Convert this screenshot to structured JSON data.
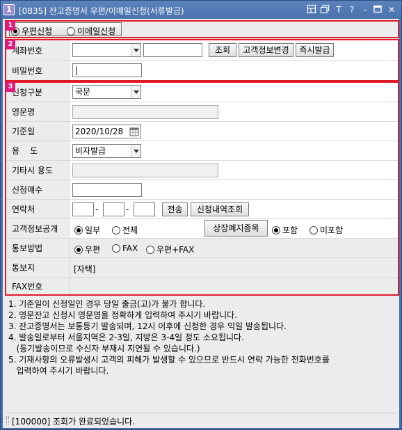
{
  "window": {
    "badge": "1",
    "title": "[0835] 잔고증명서 우편/이메일신청(서류발급)",
    "tools": [
      "layout-icon",
      "copy-window-icon",
      "text-size-icon",
      "help-icon",
      "minimize-icon",
      "maximize-icon",
      "close-icon"
    ],
    "tool_glyphs": {
      "text": "T",
      "help": "?",
      "minimize": "–",
      "close": "✕"
    }
  },
  "section1": {
    "badge": "1",
    "tabs": [
      {
        "label": "우편신청",
        "selected": true
      },
      {
        "label": "이메일신청",
        "selected": false
      }
    ]
  },
  "section2": {
    "badge": "2",
    "account_label": "계좌번호",
    "account_select_value": "",
    "account_name_value": "",
    "btn_inquiry": "조회",
    "btn_change_info": "고객정보변경",
    "btn_issue_now": "즉시발급",
    "password_label": "비밀번호",
    "password_value": "|"
  },
  "section3": {
    "badge": "3",
    "request_type_label": "신청구분",
    "request_type_value": "국문",
    "english_name_label": "영문명",
    "base_date_label": "기준일",
    "base_date_value": "2020/10/28",
    "purpose_label": "용    도",
    "purpose_value": "비자발급",
    "other_purpose_label": "기타시 용도",
    "copies_label": "신청매수",
    "contact_label": "연락처",
    "contact_dash": "-",
    "btn_send": "전송",
    "btn_history": "신청내역조회",
    "disclosure_label": "고객정보공개",
    "disclosure_opts": [
      {
        "label": "일부",
        "selected": true
      },
      {
        "label": "전체",
        "selected": false
      }
    ],
    "btn_delisted": "상장폐지종목",
    "include_opts": [
      {
        "label": "포함",
        "selected": true
      },
      {
        "label": "미포함",
        "selected": false
      }
    ],
    "notify_method_label": "통보방법",
    "notify_opts": [
      {
        "label": "우편",
        "selected": true
      },
      {
        "label": "FAX",
        "selected": false
      },
      {
        "label": "우편+FAX",
        "selected": false
      }
    ],
    "notify_place_label": "통보지",
    "notify_place_value": "[자택]",
    "fax_label": "FAX번호"
  },
  "notes": [
    "1. 기준일이 신청일인 경우 당일 출금(고)가 불가 합니다.",
    "2. 영문잔고 신청시 영문명을 정확하게 입력하여 주시기 바랍니다.",
    "3. 잔고증명서는 보통등기 발송되며, 12시 이후에 신청한 경우 익일 발송됩니다.",
    "4. 발송일로부터 서울지역은 2-3일, 지방은 3-4일 정도 소요됩니다.",
    "   (등기발송이므로 수신자 부재시 지연될 수 있습니다.)",
    "5. 기재사항의 오류발생시 고객의 피해가 발생할 수 있으므로 반드시 연락 가능한 전화번호를",
    "   입력하여 주시기 바랍니다."
  ],
  "status": {
    "text": "[100000] 조회가 완료되었습니다."
  }
}
